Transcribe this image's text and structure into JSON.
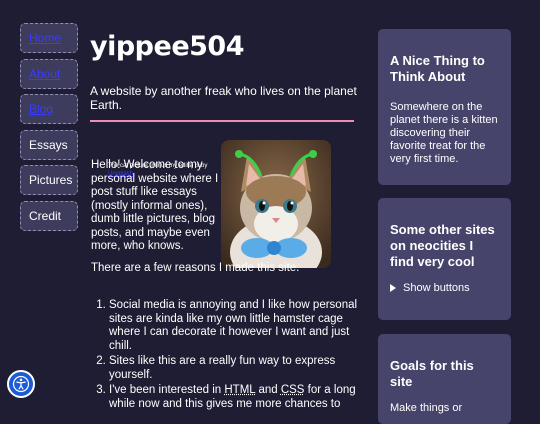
{
  "nav": {
    "items": [
      {
        "label": "Home"
      },
      {
        "label": "About"
      },
      {
        "label": "Blog"
      },
      {
        "label": "Essays"
      },
      {
        "label": "Pictures"
      },
      {
        "label": "Credit"
      }
    ]
  },
  "main": {
    "title": "yippee504",
    "tagline": "A website by another freak who lives on the planet Earth.",
    "caption_text": "The cat picture (minus my edits) is by",
    "caption_link": "Unsplash",
    "intro": "Hello! Welcome to my personal website where I post stuff like essays (mostly informal ones), dumb little pictures, blog posts, and maybe even more, who knows.",
    "reasons_intro": "There are a few reasons I made this site.",
    "reasons": {
      "r1": "Social media is annoying and I like how personal sites are kinda like my own little hamster cage where I can decorate it however I want and just chill.",
      "r2": "Sites like this are a really fun way to express yourself.",
      "r3_a": "I've been interested in ",
      "r3_html": "HTML",
      "r3_b": " and ",
      "r3_css": "CSS",
      "r3_c": " for a long while now and this gives me more chances to"
    }
  },
  "sidebar": {
    "card1": {
      "title": "A Nice Thing to Think About",
      "body": "Somewhere on the planet there is a kitten discovering their favorite treat for the very first time."
    },
    "card2": {
      "title": "Some other sites on neocities I find very cool",
      "toggle": "Show buttons"
    },
    "card3": {
      "title": "Goals for this site",
      "body": "Make things or"
    }
  },
  "colors": {
    "background": "#1f1d33",
    "card": "#46446a",
    "nav": "#3e3c5c",
    "divider": "#ef8cb1",
    "link": "#3b3bff",
    "a11y": "#1c5bd6"
  }
}
